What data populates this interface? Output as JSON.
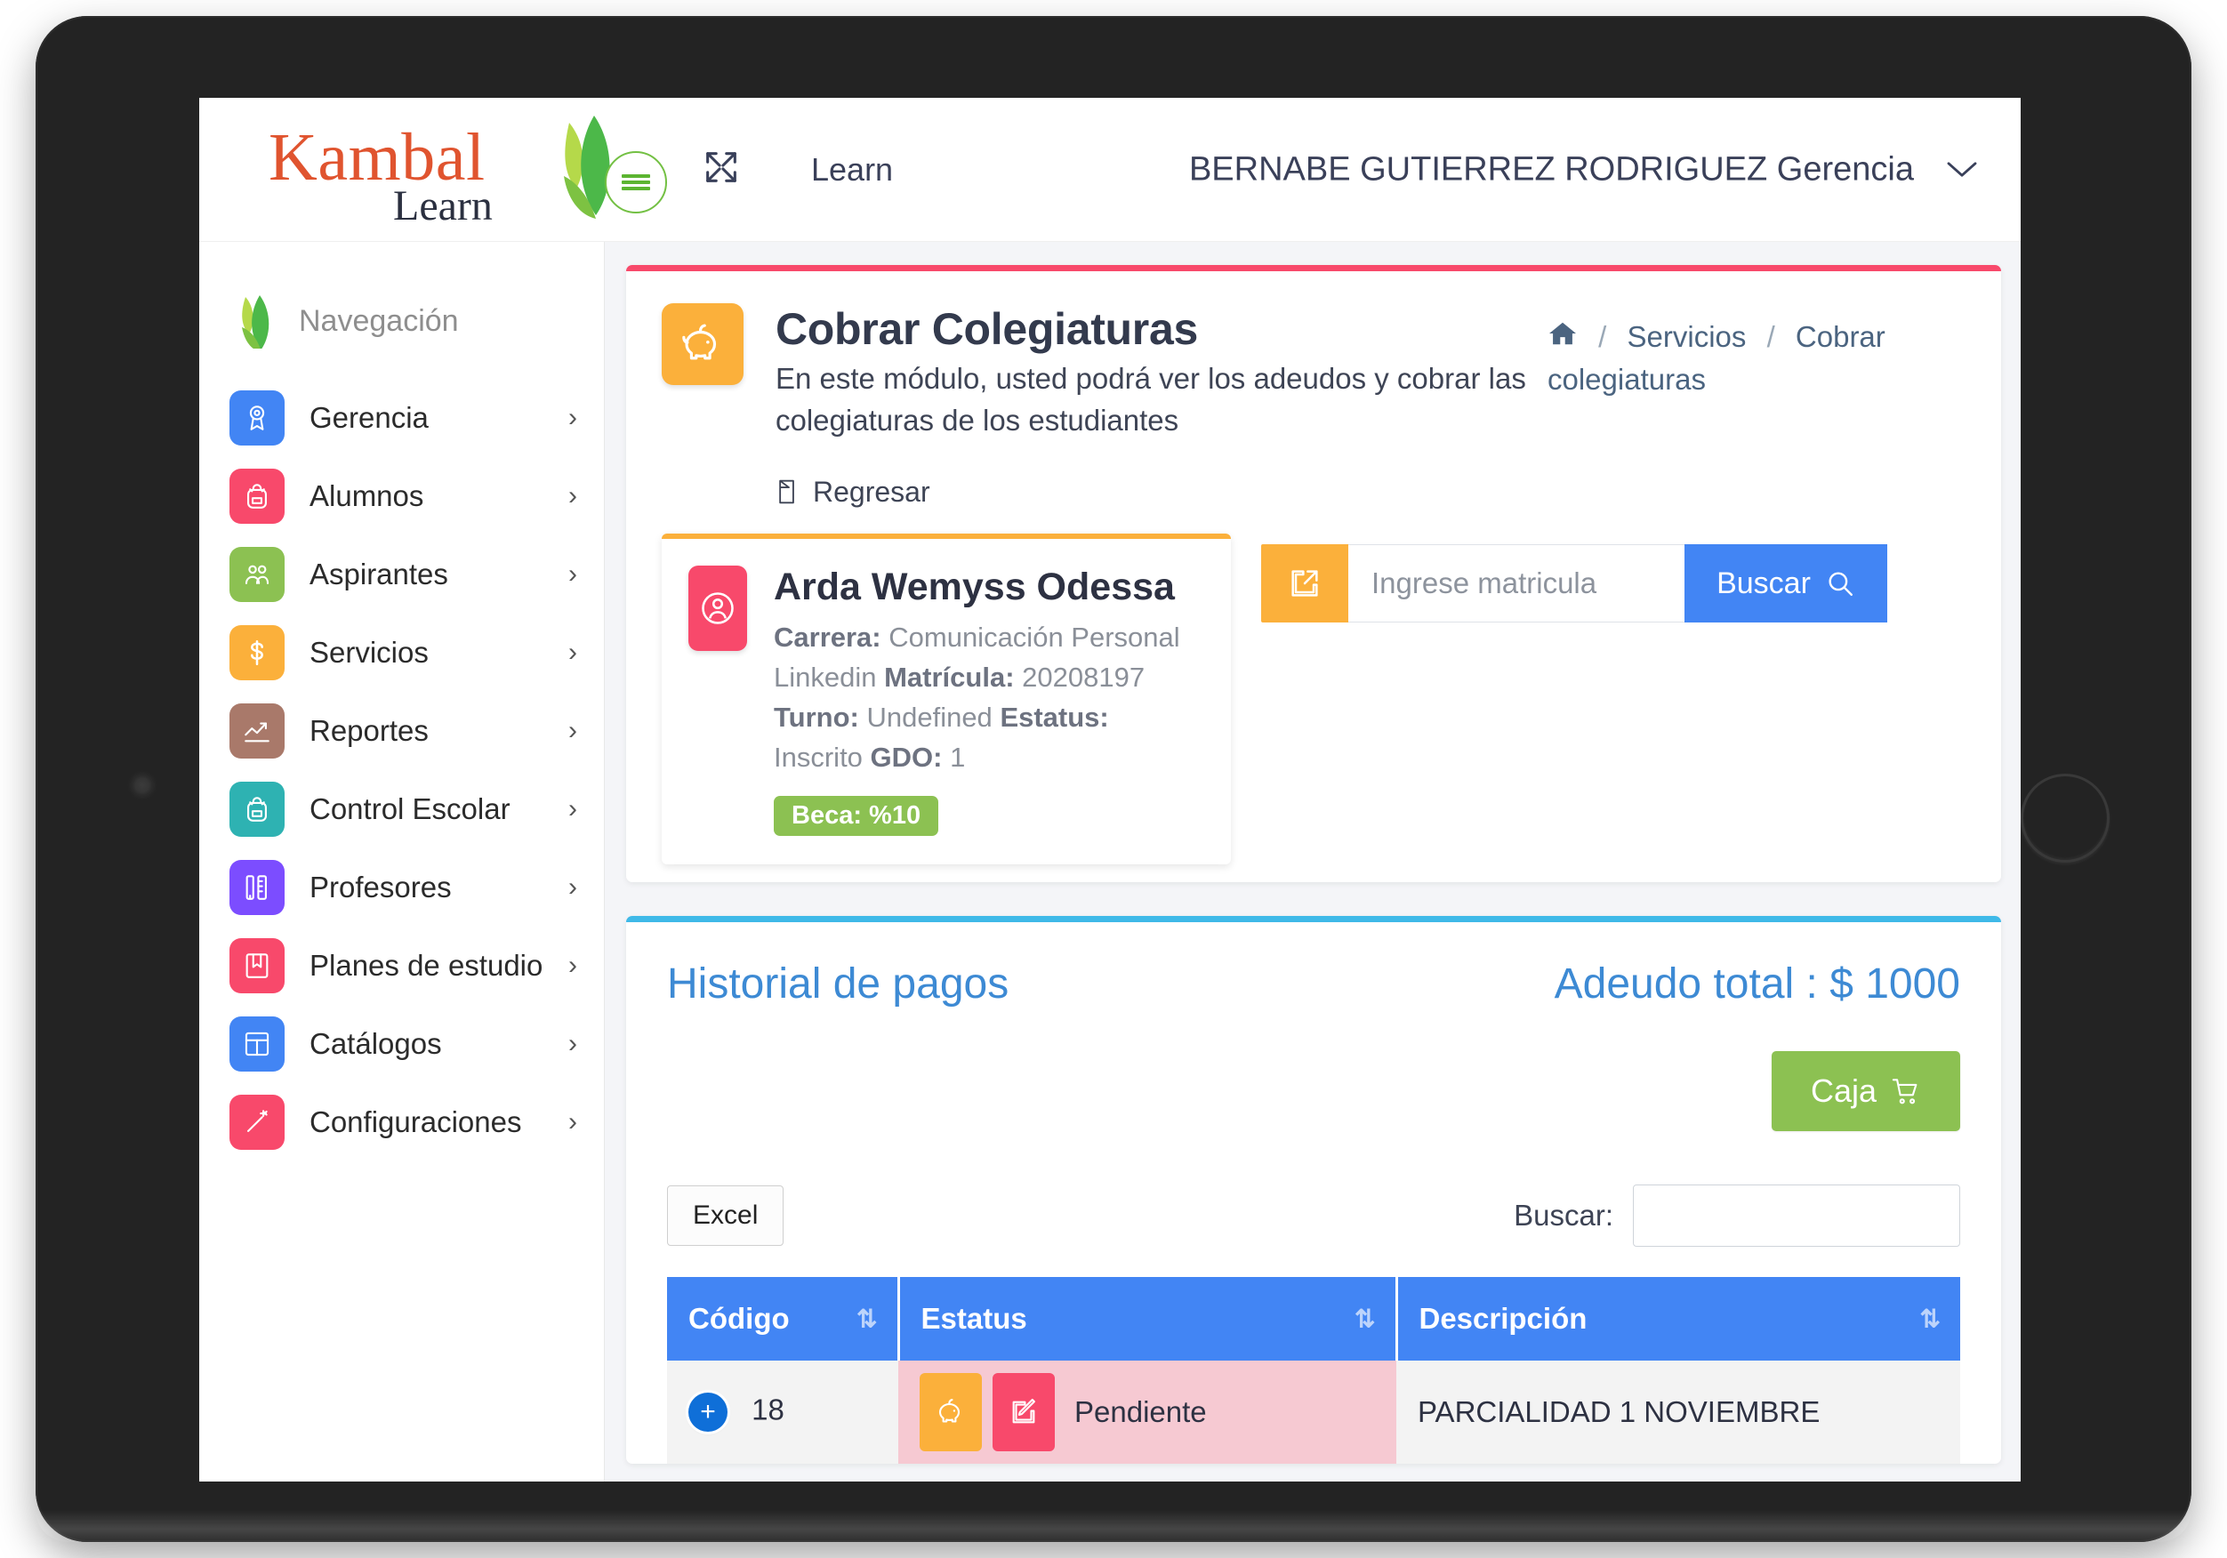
{
  "brand": {
    "name_top": "Kambal",
    "name_bottom": "Learn",
    "menu_icon": "hamburger-icon"
  },
  "topbar": {
    "expand_icon": "expand-arrows-icon",
    "app_label": "Learn",
    "user_name": "BERNABE GUTIERREZ RODRIGUEZ Gerencia",
    "caret_icon": "chevron-down-icon"
  },
  "sidebar": {
    "heading": "Navegación",
    "items": [
      {
        "label": "Gerencia",
        "color": "#4285f4",
        "icon": "medal-icon"
      },
      {
        "label": "Alumnos",
        "color": "#f8496b",
        "icon": "backpack-icon"
      },
      {
        "label": "Aspirantes",
        "color": "#8cc152",
        "icon": "people-icon"
      },
      {
        "label": "Servicios",
        "color": "#fbb03b",
        "icon": "dollar-icon"
      },
      {
        "label": "Reportes",
        "color": "#a9796a",
        "icon": "trend-up-icon"
      },
      {
        "label": "Control Escolar",
        "color": "#2eb2b2",
        "icon": "backpack-icon"
      },
      {
        "label": "Profesores",
        "color": "#7c4dff",
        "icon": "pencil-ruler-icon"
      },
      {
        "label": "Planes de estudio",
        "color": "#f8496b",
        "icon": "bookmark-icon"
      },
      {
        "label": "Catálogos",
        "color": "#4285f4",
        "icon": "layout-icon"
      },
      {
        "label": "Configuraciones",
        "color": "#f8496b",
        "icon": "magic-wand-icon"
      }
    ],
    "chevron": "›"
  },
  "page": {
    "icon": "piggy-bank-icon",
    "title": "Cobrar Colegiaturas",
    "description": "En este módulo, usted podrá ver los adeudos y cobrar las colegiaturas de los estudiantes",
    "back_label": "Regresar",
    "back_icon": "back-arrow-icon"
  },
  "breadcrumb": {
    "home_icon": "home-icon",
    "items": [
      "Servicios",
      "Cobrar colegiaturas"
    ],
    "separator": "/"
  },
  "student": {
    "avatar_icon": "user-circle-icon",
    "name": "Arda Wemyss Odessa",
    "fields": [
      {
        "label": "Carrera:",
        "value": "Comunicación Personal Linkedin"
      },
      {
        "label": "Matrícula:",
        "value": "20208197"
      },
      {
        "label": "Turno:",
        "value": "Undefined"
      },
      {
        "label": "Estatus:",
        "value": "Inscrito"
      },
      {
        "label": "GDO:",
        "value": "1"
      }
    ],
    "badge": "Beca: %10",
    "badge_color": "#8cc152"
  },
  "search": {
    "left_icon": "external-link-icon",
    "placeholder": "Ingrese matricula",
    "value": "",
    "button_label": "Buscar",
    "button_icon": "search-icon"
  },
  "history": {
    "title": "Historial de pagos",
    "total_label": "Adeudo total : $ 1000",
    "caja_label": "Caja",
    "caja_icon": "cart-icon",
    "excel_label": "Excel",
    "filter_label": "Buscar:",
    "filter_value": "",
    "table": {
      "columns": [
        "Código",
        "Estatus",
        "Descripción"
      ],
      "sort_icon": "sort-updown-icon",
      "rows": [
        {
          "codigo": "18",
          "expand_icon": "plus-circle-icon",
          "estatus_label": "Pendiente",
          "estatus_actions": [
            "piggy-bank-icon",
            "edit-square-icon"
          ],
          "descripcion": "PARCIALIDAD 1 NOVIEMBRE"
        }
      ]
    }
  },
  "colors": {
    "accent_blue": "#4285f4",
    "accent_pink": "#f8496b",
    "accent_orange": "#fbb03b",
    "accent_green": "#8cc152",
    "accent_cyan": "#3fb9e8",
    "link_blue": "#3d8ad4"
  }
}
